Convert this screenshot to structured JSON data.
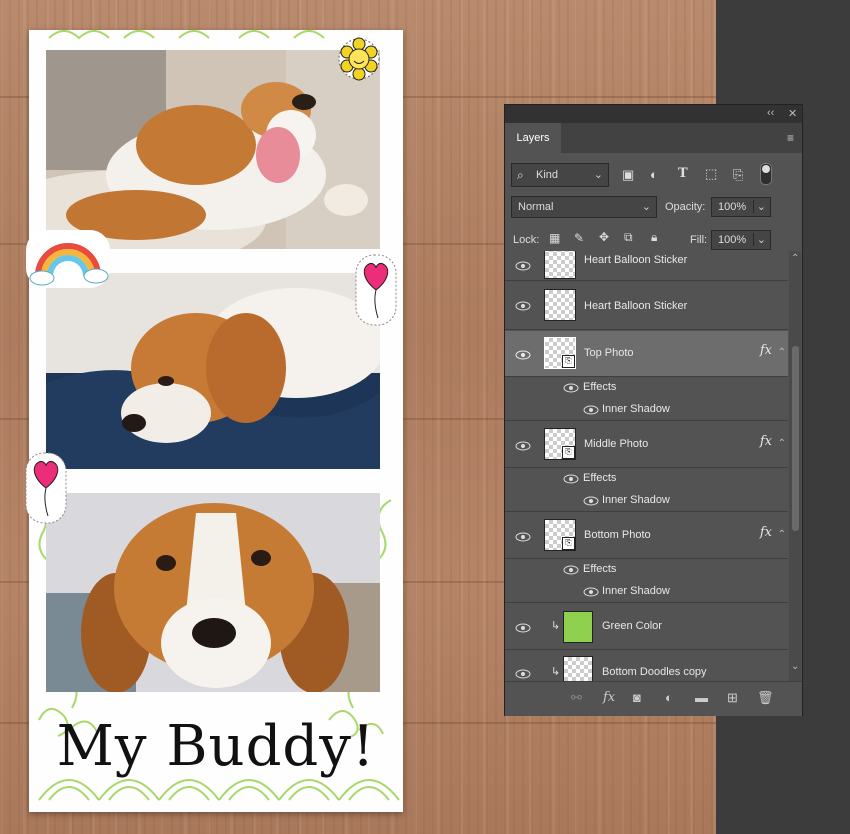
{
  "canvas": {
    "caption": "My Buddy!",
    "stickers": [
      "sunflower-sticker",
      "rainbow-sticker",
      "heart-balloon-sticker",
      "heart-balloon-sticker"
    ]
  },
  "panel": {
    "tab_label": "Layers",
    "collapse_icon": "double-chevron-icon",
    "close_icon": "close-icon",
    "filter": {
      "kind_label": "Kind",
      "icons": [
        "image-filter-icon",
        "adjustment-filter-icon",
        "type-filter-icon",
        "shape-filter-icon",
        "smart-object-filter-icon"
      ]
    },
    "blend_mode": "Normal",
    "opacity_label": "Opacity:",
    "opacity_value": "100%",
    "lock_label": "Lock:",
    "fill_label": "Fill:",
    "fill_value": "100%",
    "layers": [
      {
        "name": "Heart Balloon Sticker"
      },
      {
        "name": "Heart Balloon Sticker"
      },
      {
        "name": "Top Photo",
        "fx": "fx",
        "effects_label": "Effects",
        "effect": "Inner Shadow"
      },
      {
        "name": "Middle Photo",
        "fx": "fx",
        "effects_label": "Effects",
        "effect": "Inner Shadow"
      },
      {
        "name": "Bottom Photo",
        "fx": "fx",
        "effects_label": "Effects",
        "effect": "Inner Shadow"
      },
      {
        "name": "Green Color",
        "fill_color": "#8fd14f"
      },
      {
        "name": "Bottom Doodles copy"
      }
    ]
  },
  "colors": {
    "accent_green": "#8fd14f",
    "panel_bg": "#535353",
    "selected_row": "#6d6d6d"
  }
}
